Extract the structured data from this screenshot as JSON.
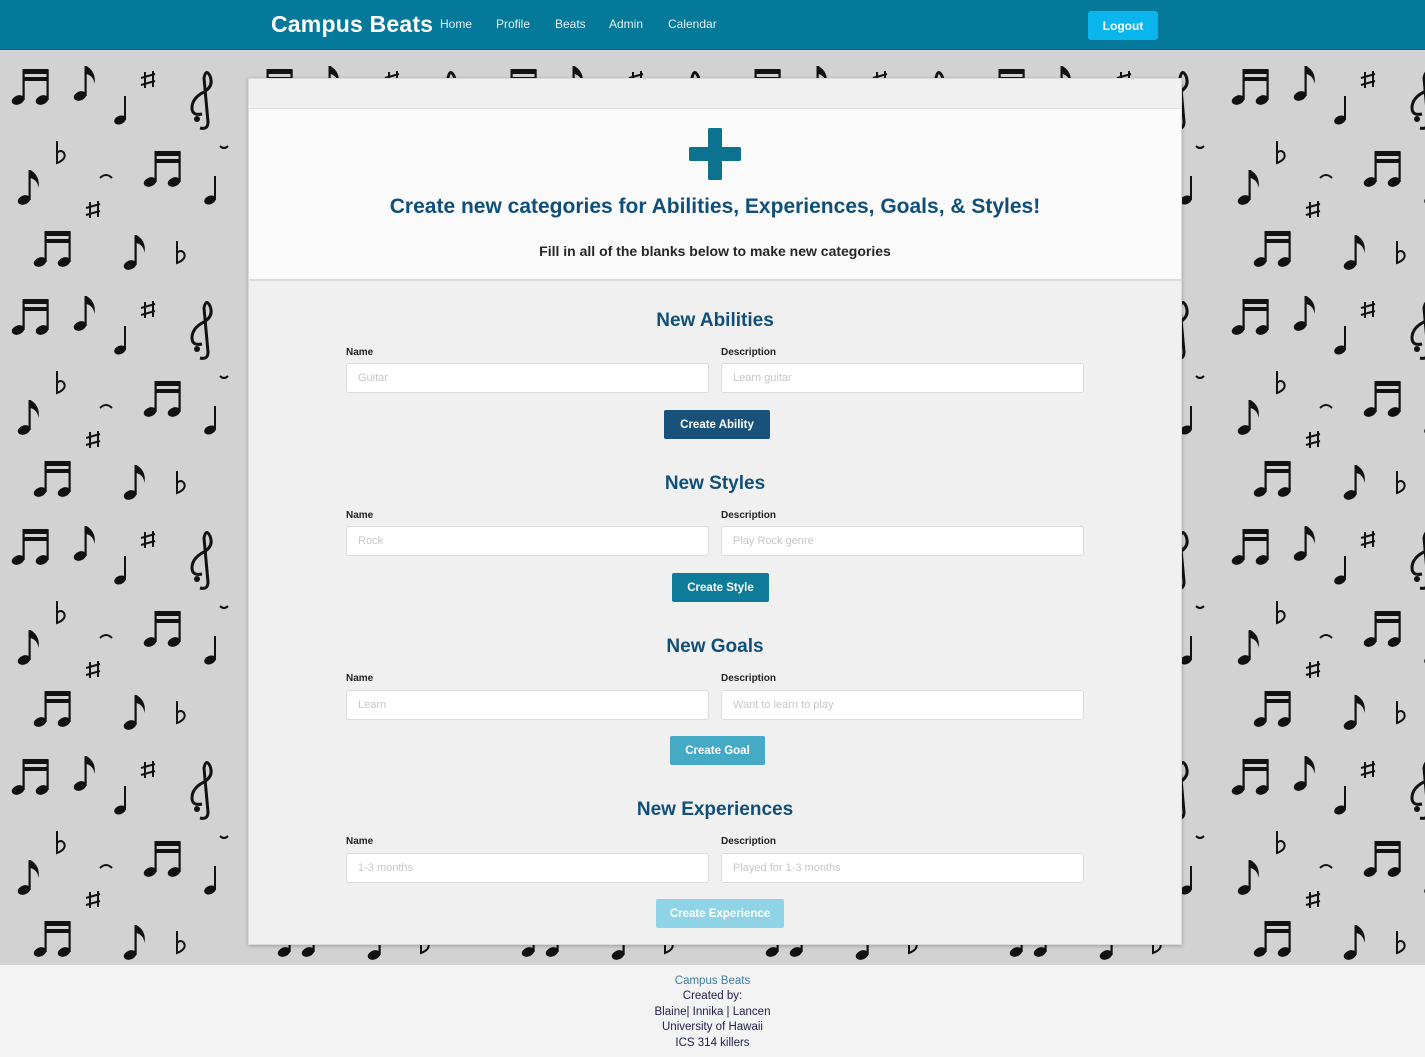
{
  "nav": {
    "brand": "Campus Beats",
    "items": [
      "Home",
      "Profile",
      "Beats",
      "Admin",
      "Calendar"
    ],
    "logout": "Logout"
  },
  "hero": {
    "title": "Create new categories for Abilities, Experiences, Goals, & Styles!",
    "subtitle": "Fill in all of the blanks below to make new categories"
  },
  "sections": [
    {
      "title": "New Abilities",
      "name_label": "Name",
      "name_placeholder": "Guitar",
      "desc_label": "Description",
      "desc_placeholder": "Learn guitar",
      "button": "Create Ability",
      "button_color": "#18527a"
    },
    {
      "title": "New Styles",
      "name_label": "Name",
      "name_placeholder": "Rock",
      "desc_label": "Description",
      "desc_placeholder": "Play Rock genre",
      "button": "Create Style",
      "button_color": "#0e7b99"
    },
    {
      "title": "New Goals",
      "name_label": "Name",
      "name_placeholder": "Learn",
      "desc_label": "Description",
      "desc_placeholder": "Want to learn to play",
      "button": "Create Goal",
      "button_color": "#44aac6"
    },
    {
      "title": "New Experiences",
      "name_label": "Name",
      "name_placeholder": "1-3 months",
      "desc_label": "Description",
      "desc_placeholder": "Played for 1-3 months",
      "button": "Create Experience",
      "button_color": "#8fd3e6"
    }
  ],
  "footer": {
    "brand": "Campus Beats",
    "created_by": "Created by:",
    "authors": "Blaine| Innika | Lancen",
    "university": "University of Hawaii",
    "team": "ICS 314 killers"
  },
  "colors": {
    "navbar": "#05799a",
    "logout": "#0ab4ec",
    "heading": "#0f4f7a",
    "plus_icon": "#0b7290"
  },
  "icons": {
    "hero": "plus-icon",
    "background": "music-notes-pattern"
  }
}
